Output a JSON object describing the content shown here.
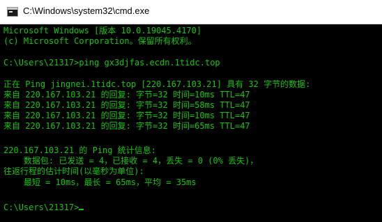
{
  "window": {
    "title": "C:\\Windows\\system32\\cmd.exe",
    "icon": "console-icon"
  },
  "console": {
    "lines": [
      "Microsoft Windows [版本 10.0.19045.4170]",
      "(c) Microsoft Corporation。保留所有权利。",
      "C:\\Users\\21317>ping gx3djfas.ecdn.1tidc.top",
      "正在 Ping jingnei.1tidc.top [220.167.103.21] 具有 32 字节的数据:",
      "来自 220.167.103.21 的回复: 字节=32 时间=10ms TTL=47",
      "来自 220.167.103.21 的回复: 字节=32 时间=58ms TTL=47",
      "来自 220.167.103.21 的回复: 字节=32 时间=10ms TTL=47",
      "来自 220.167.103.21 的回复: 字节=32 时间=65ms TTL=47",
      "220.167.103.21 的 Ping 统计信息:",
      "    数据包: 已发送 = 4，已接收 = 4，丢失 = 0 (0% 丢失)，",
      "往返行程的估计时间(以毫秒为单位):",
      "    最短 = 10ms，最长 = 65ms，平均 = 35ms",
      "C:\\Users\\21317>"
    ],
    "text_color": "#16c60c",
    "background": "#000000"
  }
}
